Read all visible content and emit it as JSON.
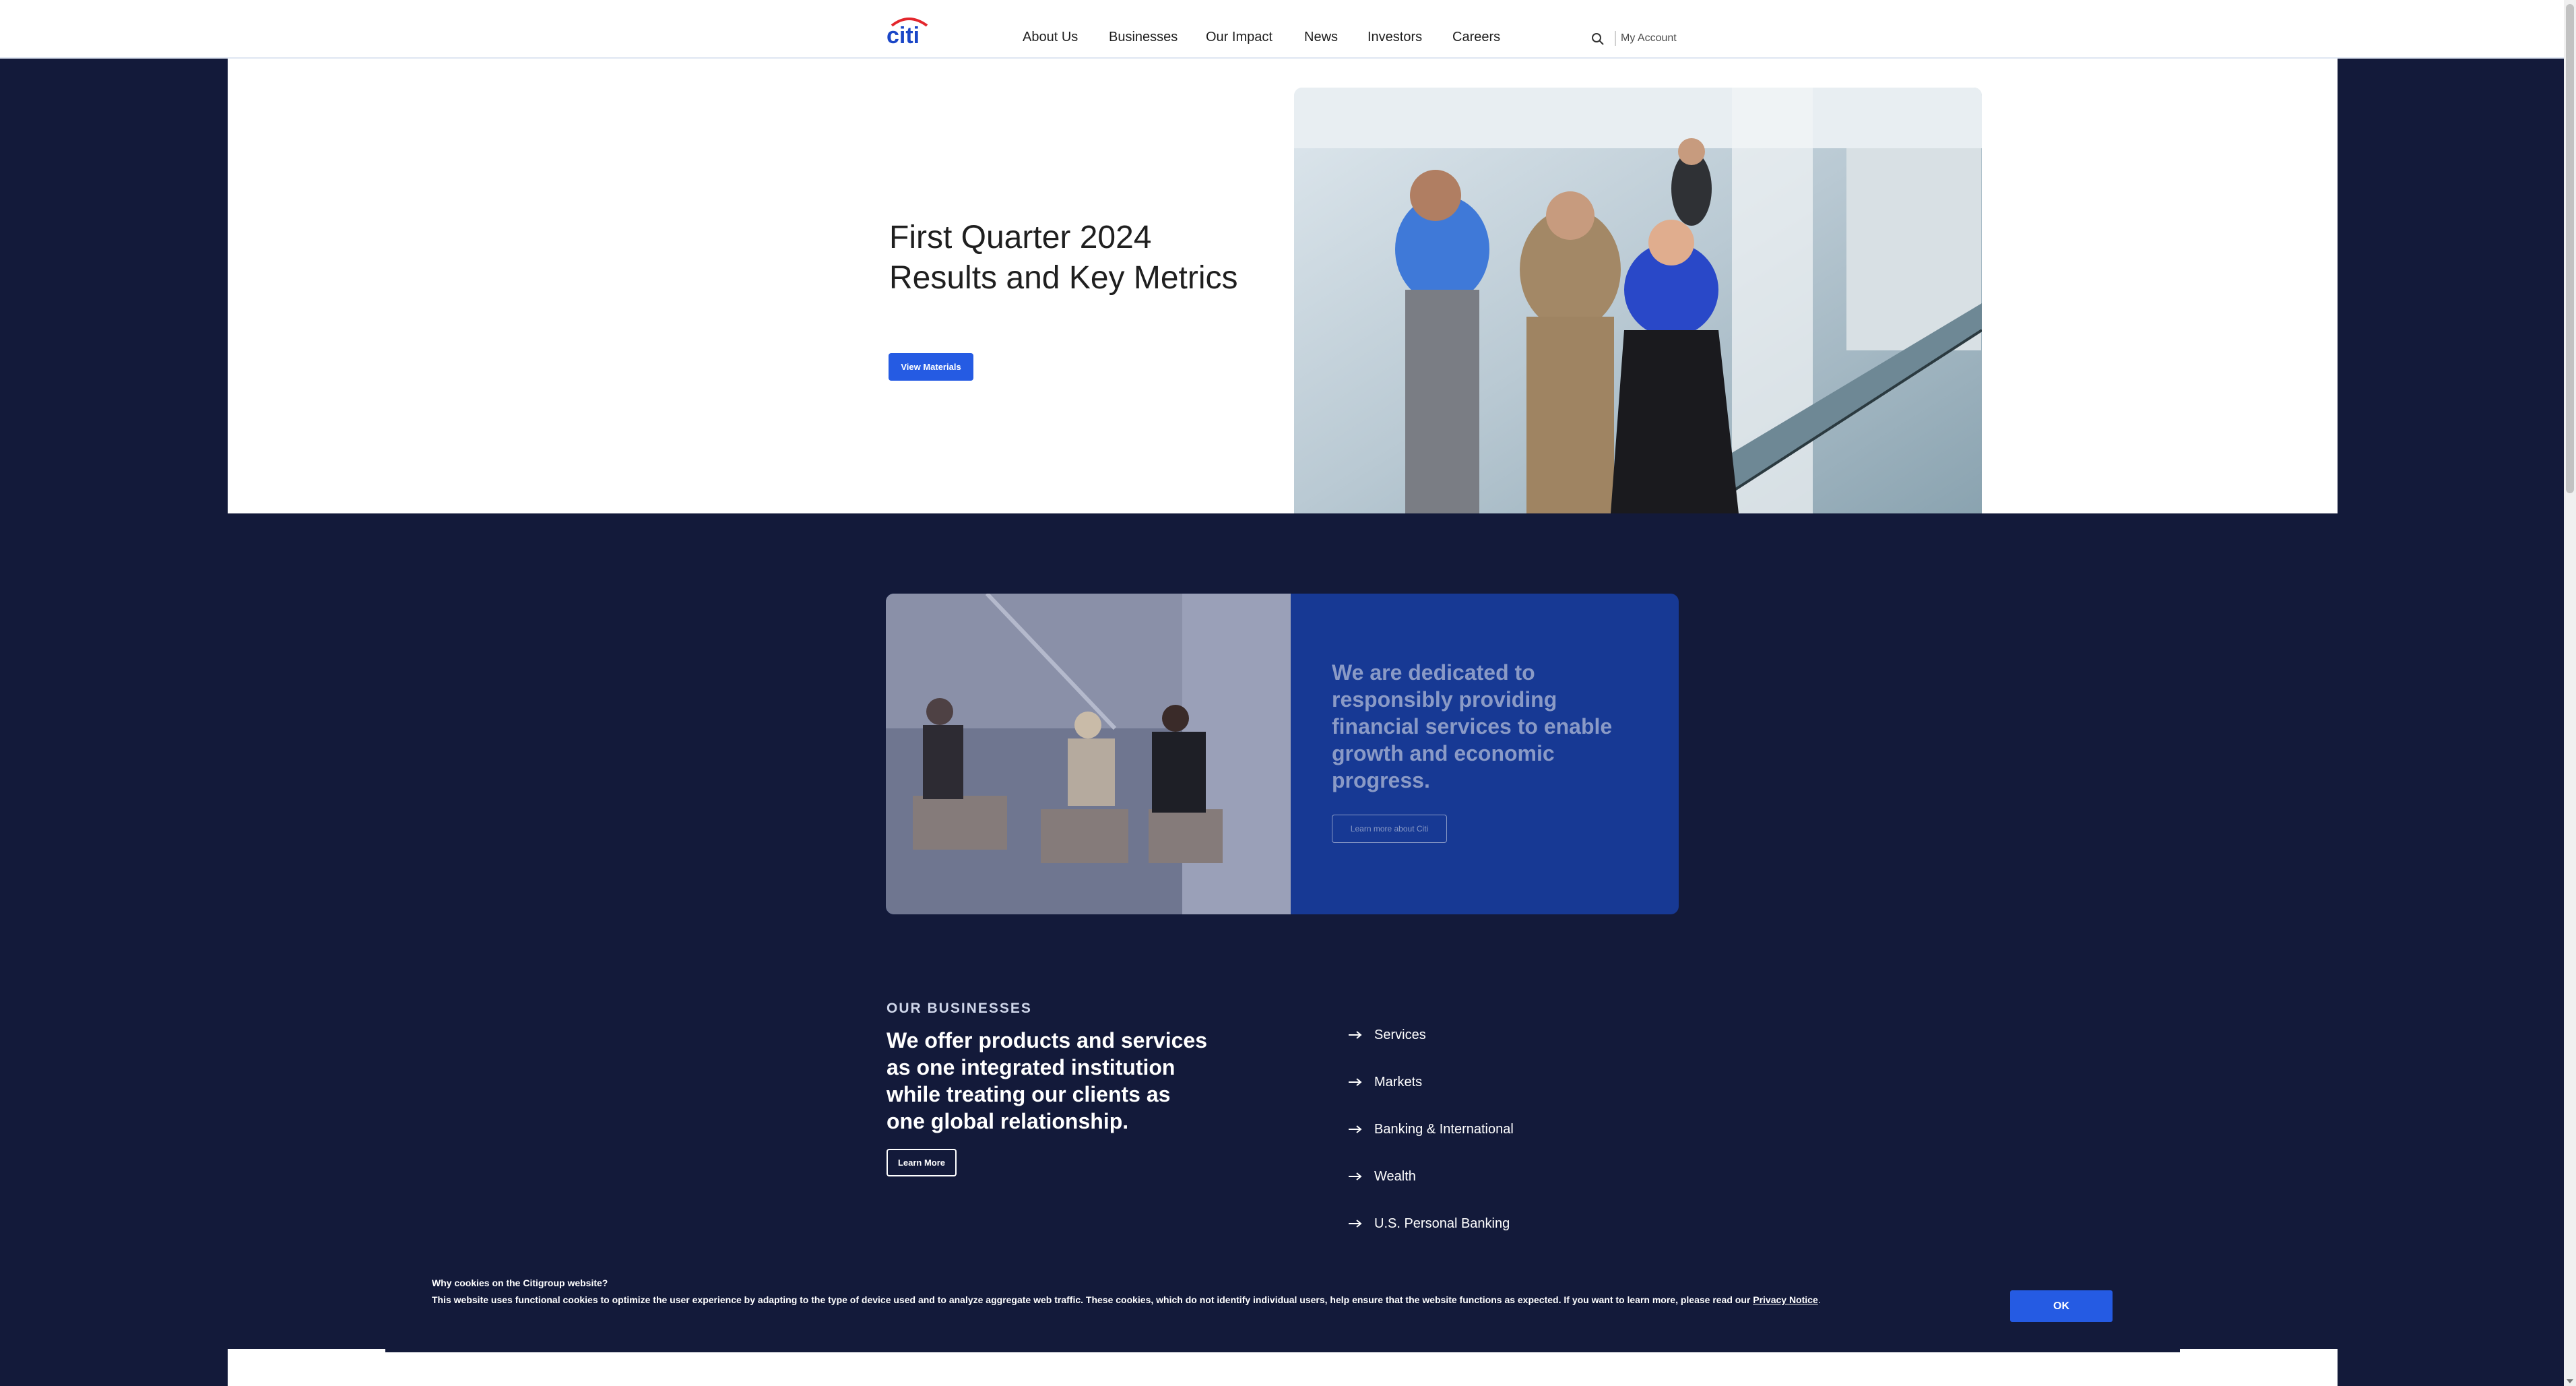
{
  "header": {
    "logo_text": "citi",
    "nav": [
      "About Us",
      "Businesses",
      "Our Impact",
      "News",
      "Investors",
      "Careers"
    ],
    "search_icon": "search-icon",
    "account_label": "My Account"
  },
  "hero": {
    "title": "First Quarter 2024 Results and Key Metrics",
    "button_label": "View Materials",
    "image": "group of colleagues walking down a staircase in an office atrium"
  },
  "mission": {
    "text": "We are dedicated to responsibly providing financial services to enable growth and economic progress.",
    "button_label": "Learn more about Citi",
    "image": "three colleagues seated in a meeting space"
  },
  "businesses": {
    "eyebrow": "OUR BUSINESSES",
    "heading": "We offer products and services as one integrated institution while treating our clients as one global relationship.",
    "button_label": "Learn More",
    "links": [
      "Services",
      "Markets",
      "Banking & International",
      "Wealth",
      "U.S. Personal Banking"
    ]
  },
  "cookie": {
    "title": "Why cookies on the Citigroup website?",
    "body": "This website uses functional cookies to optimize the user experience by adapting to the type of device used and to analyze aggregate web traffic. These cookies, which do not identify individual users, help ensure that the website functions as expected. If you want to learn more, please read our",
    "link_label": "Privacy Notice",
    "suffix": ".",
    "ok_label": "OK"
  },
  "colors": {
    "navy_background": "#131a3a",
    "accent_blue": "#255be3",
    "mission_blue": "#173994",
    "logo_red": "#e3262c",
    "logo_blue": "#1a46c7"
  }
}
